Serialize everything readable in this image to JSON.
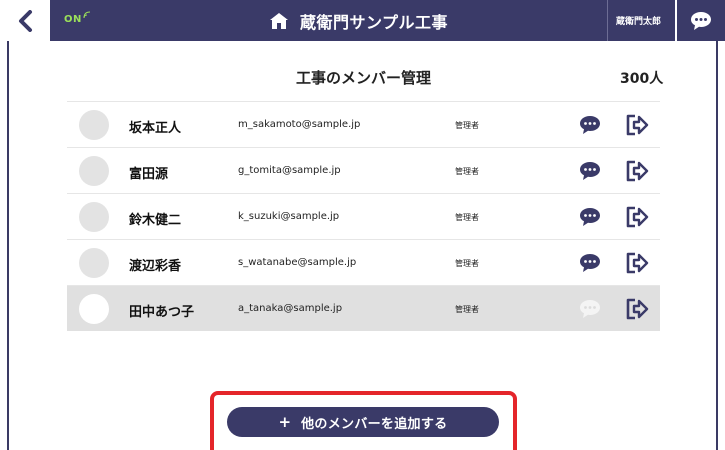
{
  "header": {
    "status_label": "ON",
    "app_title": "蔵衛門サンプル工事",
    "user_name": "蔵衛門太郎"
  },
  "section": {
    "title": "工事のメンバー管理",
    "member_count": "300人"
  },
  "members": [
    {
      "name": "坂本正人",
      "email": "m_sakamoto@sample.jp",
      "role": "管理者"
    },
    {
      "name": "富田源",
      "email": "g_tomita@sample.jp",
      "role": "管理者"
    },
    {
      "name": "鈴木健二",
      "email": "k_suzuki@sample.jp",
      "role": "管理者"
    },
    {
      "name": "渡辺彩香",
      "email": "s_watanabe@sample.jp",
      "role": "管理者"
    },
    {
      "name": "田中あつ子",
      "email": "a_tanaka@sample.jp",
      "role": "管理者"
    }
  ],
  "add_button": {
    "plus": "+",
    "label": "他のメンバーを追加する"
  },
  "colors": {
    "brand": "#3a3a68",
    "highlight": "#e4252a",
    "status_green": "#9be05a",
    "selected_row": "#e0e0e0"
  }
}
